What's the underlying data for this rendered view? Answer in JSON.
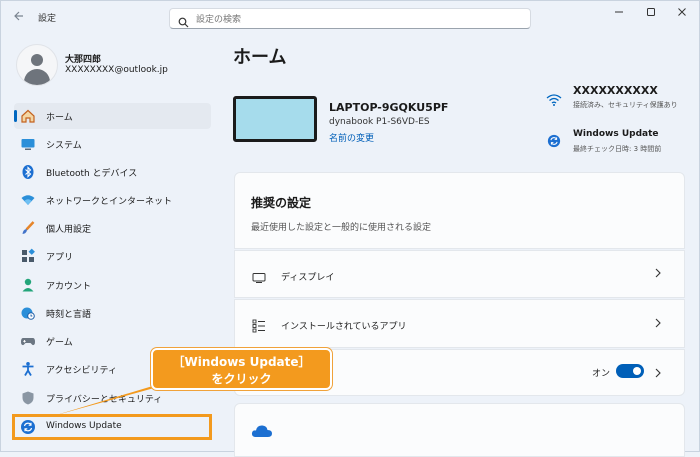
{
  "app": {
    "title": "設定"
  },
  "search": {
    "placeholder": "設定の検索"
  },
  "user": {
    "name": "大那四郎",
    "email": "XXXXXXXX@outlook.jp"
  },
  "nav": {
    "items": [
      {
        "label": "ホーム",
        "icon": "home-icon"
      },
      {
        "label": "システム",
        "icon": "monitor-icon"
      },
      {
        "label": "Bluetooth とデバイス",
        "icon": "bluetooth-icon"
      },
      {
        "label": "ネットワークとインターネット",
        "icon": "wifi-icon"
      },
      {
        "label": "個人用設定",
        "icon": "brush-icon"
      },
      {
        "label": "アプリ",
        "icon": "apps-icon"
      },
      {
        "label": "アカウント",
        "icon": "account-icon"
      },
      {
        "label": "時刻と言語",
        "icon": "globe-clock-icon"
      },
      {
        "label": "ゲーム",
        "icon": "gamepad-icon"
      },
      {
        "label": "アクセシビリティ",
        "icon": "accessibility-icon"
      },
      {
        "label": "プライバシーとセキュリティ",
        "icon": "shield-icon"
      },
      {
        "label": "Windows Update",
        "icon": "windows-update-icon"
      }
    ]
  },
  "main": {
    "title": "ホーム",
    "device": {
      "name": "LAPTOP-9GQKU5PF",
      "model": "dynabook P1-S6VD-ES",
      "rename": "名前の変更"
    },
    "network": {
      "name": "XXXXXXXXXX",
      "status": "接続済み、セキュリティ保護あり"
    },
    "update": {
      "title": "Windows Update",
      "status": "最終チェック日時: 3 時間前"
    },
    "recommended": {
      "title": "推奨の設定",
      "subtitle": "最近使用した設定と一般的に使用される設定",
      "rows": [
        {
          "label": "ディスプレイ"
        },
        {
          "label": "インストールされているアプリ"
        }
      ],
      "toggle_label": "オン"
    }
  },
  "callout": {
    "line1": "［Windows Update］",
    "line2": "をクリック"
  },
  "colors": {
    "accent": "#0067c0",
    "callout": "#f39a1e"
  }
}
